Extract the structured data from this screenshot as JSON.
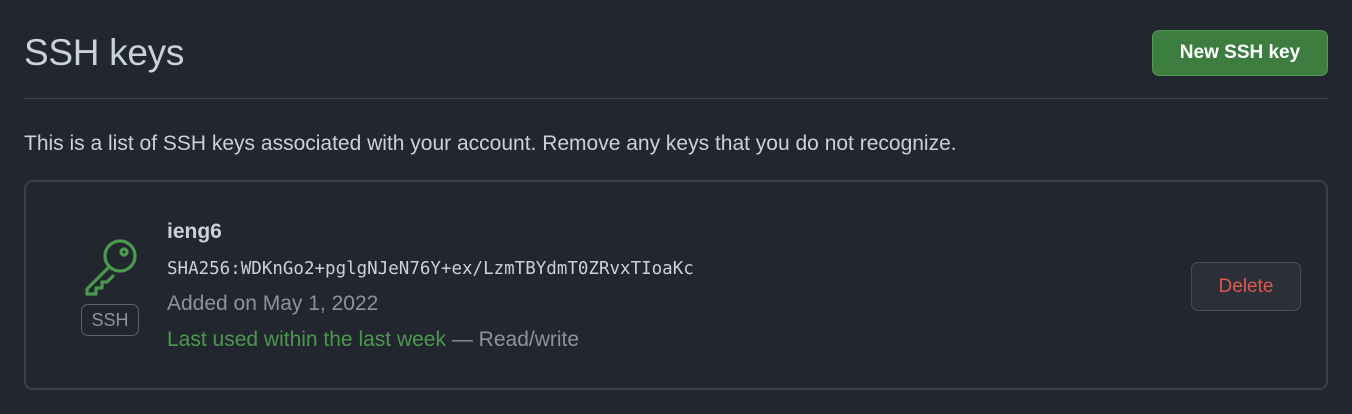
{
  "header": {
    "title": "SSH keys",
    "new_key_label": "New SSH key"
  },
  "description": "This is a list of SSH keys associated with your account. Remove any keys that you do not recognize.",
  "keys": [
    {
      "icon": "key-icon",
      "badge": "SSH",
      "name": "ieng6",
      "fingerprint": "SHA256:WDKnGo2+pglgNJeN76Y+ex/LzmTBYdmT0ZRvxTIoaKc",
      "added_on": "Added on May 1, 2022",
      "last_used": "Last used within the last week",
      "separator": " — ",
      "access": "Read/write",
      "delete_label": "Delete"
    }
  ],
  "colors": {
    "background": "#22262e",
    "primary_button": "#3e7d40",
    "last_used_green": "#4a9a4e",
    "key_icon_green": "#4a9a4e",
    "delete_red": "#e0584d"
  }
}
